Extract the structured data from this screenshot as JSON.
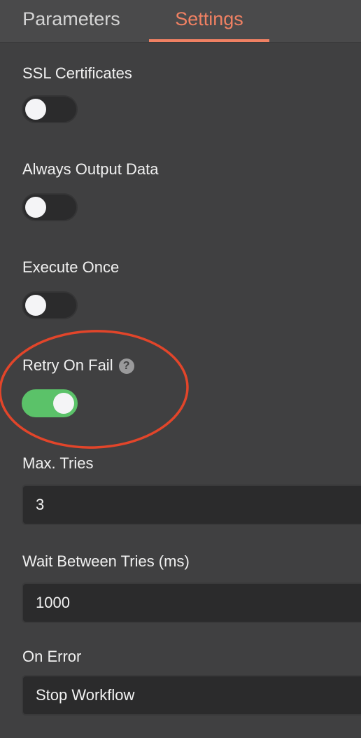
{
  "tabs": {
    "parameters": "Parameters",
    "settings": "Settings",
    "active": "settings"
  },
  "settings": {
    "ssl_certificates": {
      "label": "SSL Certificates",
      "enabled": false
    },
    "always_output_data": {
      "label": "Always Output Data",
      "enabled": false
    },
    "execute_once": {
      "label": "Execute Once",
      "enabled": false
    },
    "retry_on_fail": {
      "label": "Retry On Fail",
      "enabled": true,
      "help_icon": "question-circle-icon"
    },
    "max_tries": {
      "label": "Max. Tries",
      "value": "3"
    },
    "wait_between_tries": {
      "label": "Wait Between Tries (ms)",
      "value": "1000"
    },
    "on_error": {
      "label": "On Error",
      "value": "Stop Workflow"
    }
  },
  "colors": {
    "accent": "#f08163",
    "toggle_on": "#5bc269",
    "annotation": "#e2452a",
    "background": "#404041"
  }
}
